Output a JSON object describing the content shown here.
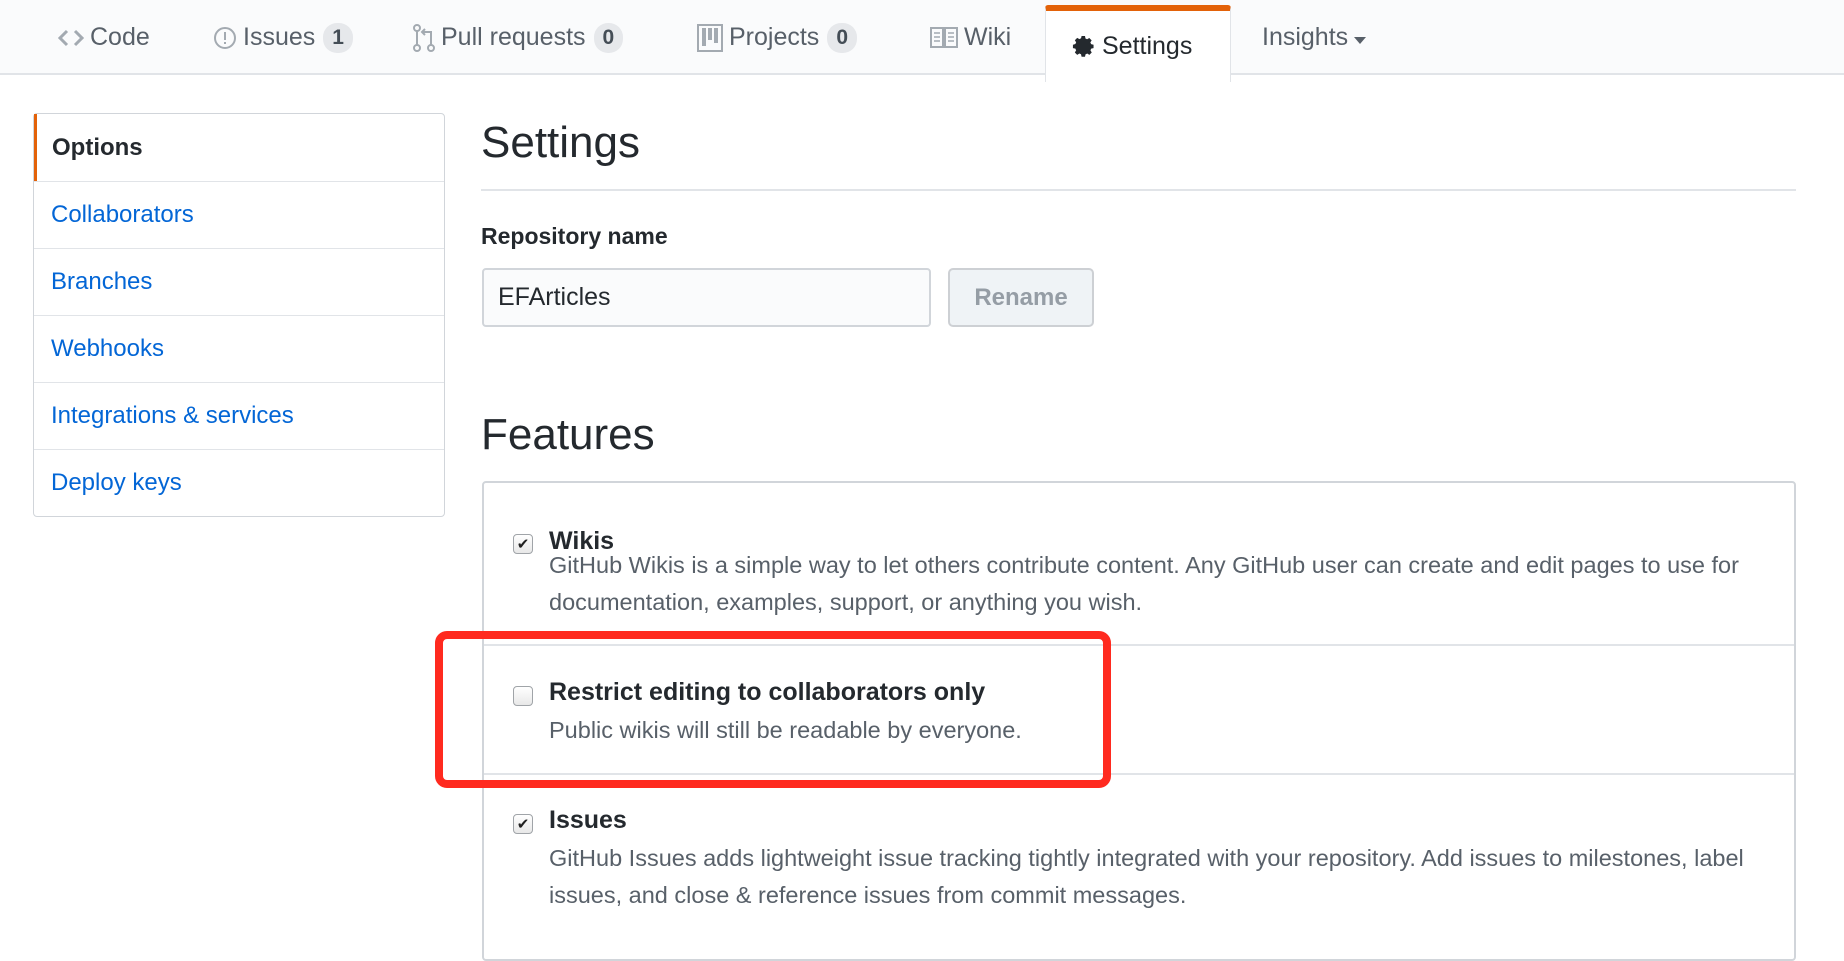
{
  "nav": {
    "tabs": [
      {
        "label": "Code",
        "icon": "code-icon"
      },
      {
        "label": "Issues",
        "icon": "issue-opened-icon",
        "count": "1"
      },
      {
        "label": "Pull requests",
        "icon": "git-pull-request-icon",
        "count": "0"
      },
      {
        "label": "Projects",
        "icon": "project-icon",
        "count": "0"
      },
      {
        "label": "Wiki",
        "icon": "book-icon"
      },
      {
        "label": "Settings",
        "icon": "gear-icon",
        "active": true
      },
      {
        "label": "Insights",
        "icon": "triangle-down-icon"
      }
    ]
  },
  "sidebar": {
    "items": [
      {
        "label": "Options",
        "selected": true
      },
      {
        "label": "Collaborators"
      },
      {
        "label": "Branches"
      },
      {
        "label": "Webhooks"
      },
      {
        "label": "Integrations & services"
      },
      {
        "label": "Deploy keys"
      }
    ]
  },
  "main": {
    "title": "Settings",
    "repo_name_label": "Repository name",
    "repo_name_value": "EFArticles",
    "rename_button": "Rename",
    "features_title": "Features",
    "features": [
      {
        "title": "Wikis",
        "checked": true,
        "description": "GitHub Wikis is a simple way to let others contribute content. Any GitHub user can create and edit pages to use for documentation, examples, support, or anything you wish."
      },
      {
        "title": "Restrict editing to collaborators only",
        "checked": false,
        "description": "Public wikis will still be readable by everyone."
      },
      {
        "title": "Issues",
        "checked": true,
        "description": "GitHub Issues adds lightweight issue tracking tightly integrated with your repository. Add issues to milestones, label issues, and close & reference issues from commit messages."
      }
    ]
  },
  "colors": {
    "accent": "#e36209",
    "link": "#0366d6",
    "highlight": "#ff2a1f"
  }
}
